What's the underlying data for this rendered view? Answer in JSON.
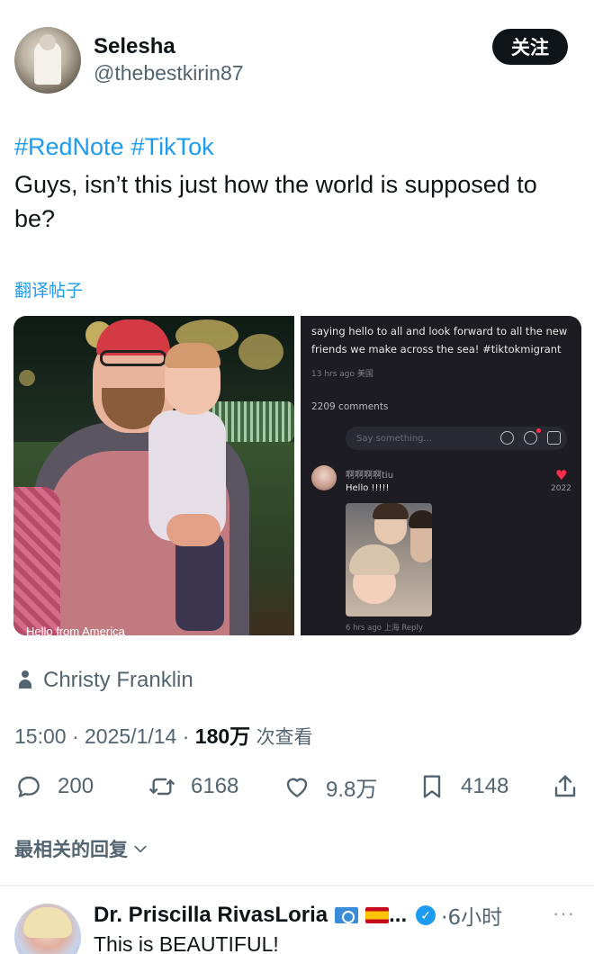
{
  "author": {
    "name": "Selesha",
    "handle": "@thebestkirin87",
    "follow_label": "关注"
  },
  "post": {
    "hashtags": [
      "#RedNote",
      "#TikTok"
    ],
    "text": "Guys, isn’t this just how the world is supposed to be?",
    "translate_label": "翻译帖子"
  },
  "media": {
    "left_caption": "Hello from America",
    "right_screenshot": {
      "line1": "saying hello to all and look forward to all the new",
      "line2": "friends we make across the sea!  #tiktokmigrant",
      "time": "13 hrs ago 美国",
      "comments_count": "2209 comments",
      "input_placeholder": "Say something...",
      "comment_user": "啊啊啊啊tiu",
      "comment_text": "Hello !!!!!",
      "comment_likes": "2022",
      "comment_meta": "6 hrs ago 上海  Reply"
    }
  },
  "credit": {
    "name": "Christy Franklin",
    "icon": "person-icon"
  },
  "meta": {
    "time": "15:00",
    "date": "2025/1/14",
    "views": "180万",
    "views_label": "次查看"
  },
  "actions": {
    "replies": "200",
    "reposts": "6168",
    "likes": "9.8万",
    "bookmarks": "4148"
  },
  "related_label": "最相关的回复",
  "reply": {
    "name": "Dr. Priscilla RivasLoria",
    "ellipsis": "...",
    "time": "·6小时",
    "text": "This is BEAUTIFUL!",
    "verified_icon": "verified-badge-icon"
  },
  "colors": {
    "accent": "#1d9bf0",
    "text": "#0f1419",
    "secondary": "#536471"
  }
}
